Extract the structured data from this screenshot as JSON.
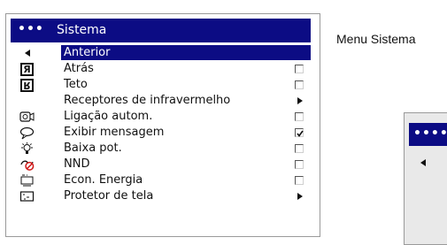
{
  "menu": {
    "dots": "•••",
    "title": "Sistema",
    "items": [
      {
        "icon": "back-arrow-icon",
        "label": "Anterior",
        "control": "none",
        "selected": true
      },
      {
        "icon": "rear-projection-icon",
        "label": "Atrás",
        "control": "checkbox",
        "checked": false
      },
      {
        "icon": "ceiling-mount-icon",
        "label": "Teto",
        "control": "checkbox",
        "checked": false
      },
      {
        "icon": "",
        "label": "Receptores de infravermelho",
        "control": "submenu"
      },
      {
        "icon": "auto-link-icon",
        "label": "Ligação autom.",
        "control": "checkbox",
        "checked": false
      },
      {
        "icon": "message-bubble-icon",
        "label": "Exibir mensagem",
        "control": "checkbox",
        "checked": true
      },
      {
        "icon": "lamp-icon",
        "label": "Baixa pot.",
        "control": "checkbox",
        "checked": false
      },
      {
        "icon": "no-signal-icon",
        "label": "NND",
        "control": "checkbox",
        "checked": false
      },
      {
        "icon": "energy-saver-icon",
        "label": "Econ. Energia",
        "control": "checkbox",
        "checked": false
      },
      {
        "icon": "screen-saver-icon",
        "label": "Protetor de tela",
        "control": "submenu"
      }
    ]
  },
  "caption": "Menu Sistema",
  "second_panel": {
    "dots": "••••"
  },
  "colors": {
    "titlebar": "#0c0c84",
    "highlight": "#0c0c84"
  }
}
